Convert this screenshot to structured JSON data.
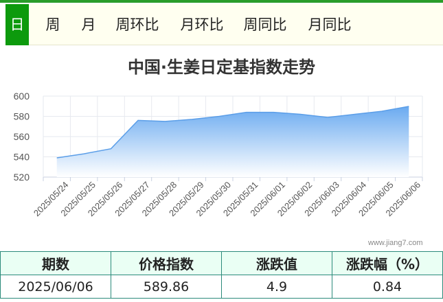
{
  "tabs": [
    {
      "label": "日",
      "active": true
    },
    {
      "label": "周",
      "active": false
    },
    {
      "label": "月",
      "active": false
    },
    {
      "label": "周环比",
      "active": false
    },
    {
      "label": "月环比",
      "active": false
    },
    {
      "label": "周同比",
      "active": false
    },
    {
      "label": "月同比",
      "active": false
    }
  ],
  "watermark": "www.jiang7.com",
  "chart_data": {
    "type": "area",
    "title": "中国·生姜日定基指数走势",
    "xlabel": "",
    "ylabel": "",
    "categories": [
      "2025/05/24",
      "2025/05/25",
      "2025/05/26",
      "2025/05/27",
      "2025/05/28",
      "2025/05/29",
      "2025/05/30",
      "2025/05/31",
      "2025/06/01",
      "2025/06/02",
      "2025/06/03",
      "2025/06/04",
      "2025/06/05",
      "2025/06/06"
    ],
    "series": [
      {
        "values": [
          539,
          543,
          548,
          576,
          575,
          577,
          580,
          584,
          584,
          582,
          579,
          582,
          585,
          589.86
        ]
      }
    ],
    "ylim": [
      520,
      600
    ],
    "yticks": [
      520,
      540,
      560,
      580,
      600
    ],
    "grid": true,
    "colors": {
      "fill_top": "#6aaaf0",
      "fill_bottom": "#ffffff",
      "line": "#5b9ee8"
    }
  },
  "summary": {
    "headers": [
      "期数",
      "价格指数",
      "涨跌值",
      "涨跌幅（%）"
    ],
    "row": [
      "2025/06/06",
      "589.86",
      "4.9",
      "0.84"
    ]
  }
}
